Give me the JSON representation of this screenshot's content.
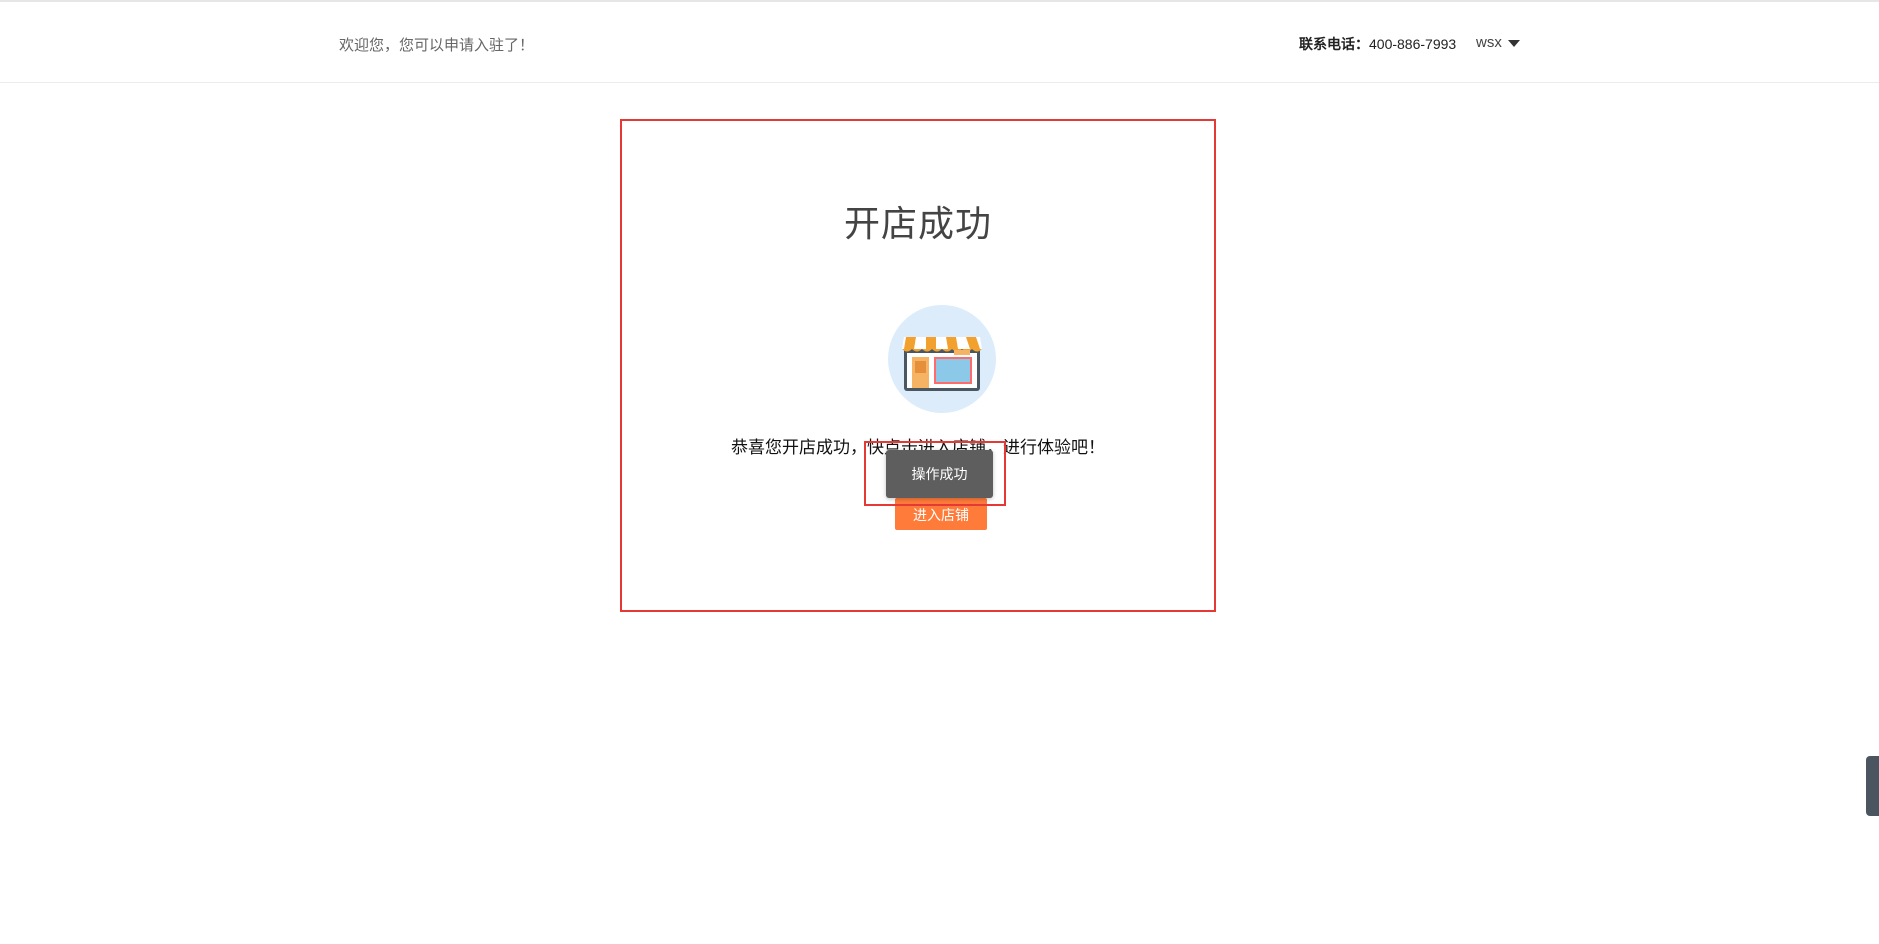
{
  "header": {
    "welcome_text": "欢迎您，您可以申请入驻了！",
    "contact_label": "联系电话：",
    "contact_phone": "400-886-7993",
    "username": "wsx"
  },
  "panel": {
    "title": "开店成功",
    "congrats_text": "恭喜您开店成功，快点击进入店铺，进行体验吧！",
    "enter_button_label": "进入店铺"
  },
  "toast": {
    "message": "操作成功"
  },
  "colors": {
    "accent_orange": "#ff7b3a",
    "highlight_red": "#e53935",
    "toast_bg": "#5e5e5e",
    "icon_circle": "#dcecfb"
  },
  "icons": {
    "shop": "shop-storefront-icon",
    "dropdown": "chevron-down-icon"
  }
}
